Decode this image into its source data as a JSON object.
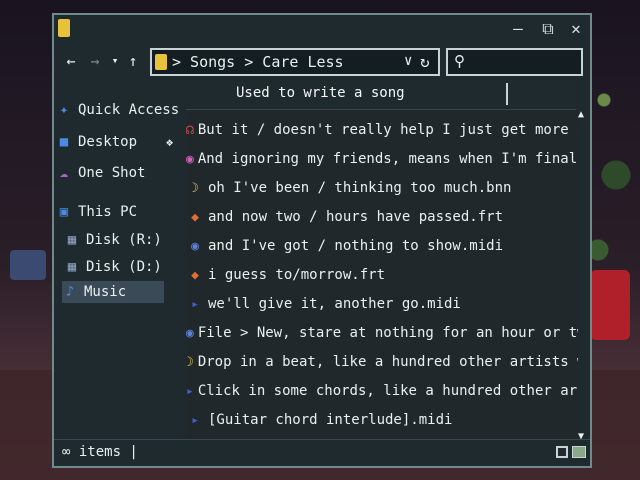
{
  "address": {
    "path": "> Songs > Care Less"
  },
  "tooltip": {
    "text": "Used to write a song"
  },
  "sidebar": {
    "items": [
      {
        "label": "Quick Access",
        "icon": "star-icon",
        "color": "#4a8ae0"
      },
      {
        "label": "Desktop",
        "icon": "desktop-icon",
        "color": "#4a8ae0"
      },
      {
        "label": "One Shot",
        "icon": "cloud-icon",
        "color": "#b060d0"
      },
      {
        "label": "This PC",
        "icon": "monitor-icon",
        "color": "#4a8ae0"
      },
      {
        "label": "Disk (R:)",
        "icon": "disk-icon",
        "color": "#8aa0c0"
      },
      {
        "label": "Disk (D:)",
        "icon": "disk-icon",
        "color": "#8aa0c0"
      },
      {
        "label": "Music",
        "icon": "music-note-icon",
        "color": "#4a8ae0"
      }
    ]
  },
  "files": [
    {
      "name": "But it / doesn't really help I just get more de",
      "icon": "headphones-icon"
    },
    {
      "name": "And ignoring my friends, means when I'm finally",
      "icon": "app-icon"
    },
    {
      "name": "oh I've been / thinking too much.bnn",
      "icon": "banana-icon"
    },
    {
      "name": "and now two / hours have passed.frt",
      "icon": "fruit-icon"
    },
    {
      "name": "and I've got / nothing to show.midi",
      "icon": "midi-icon"
    },
    {
      "name": "i guess to/morrow.frt",
      "icon": "fruit-icon"
    },
    {
      "name": "we'll give it, another go.midi",
      "icon": "midi-file-icon"
    },
    {
      "name": "File > New, stare at nothing for an hour or two",
      "icon": "midi-icon"
    },
    {
      "name": "Drop in a beat, like a hundred other artists we",
      "icon": "banana-icon"
    },
    {
      "name": "Click in some chords, like a hundred other artis",
      "icon": "midi-file-icon"
    },
    {
      "name": "[Guitar chord interlude].midi",
      "icon": "midi-file-icon"
    }
  ],
  "status": {
    "text": "∞ items |"
  }
}
